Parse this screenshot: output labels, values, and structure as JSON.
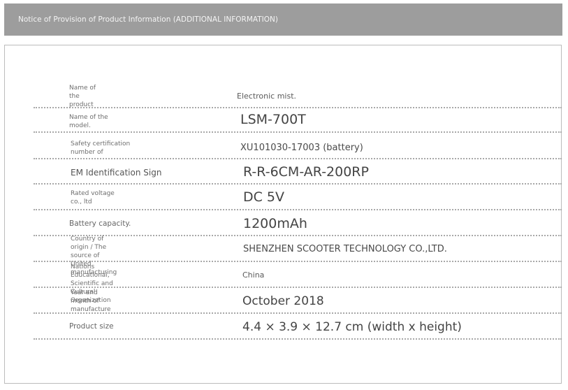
{
  "header": {
    "title": "Notice of Provision of Product Information (ADDITIONAL INFORMATION)"
  },
  "rows": [
    {
      "label": "Name of the product",
      "value": "Electronic mist."
    },
    {
      "label": "Name of the model.",
      "value": "LSM-700T"
    },
    {
      "label": "Safety certification number of",
      "value": "XU101030-17003 (battery)"
    },
    {
      "label": "EM Identification Sign",
      "value": "R-R-6CM-AR-200RP"
    },
    {
      "label": "Rated voltage co., ltd",
      "value": "DC 5V"
    },
    {
      "label": "Battery capacity.",
      "value": "1200mAh"
    },
    {
      "label": "Country of origin / The source of United manufacturing",
      "value": "SHENZHEN SCOOTER TECHNOLOGY CO.,LTD."
    },
    {
      "label": "Nations Educational, Scientific and Cultural Organization",
      "value": "China"
    },
    {
      "label": "Year and month of manufacture",
      "value": "October 2018"
    },
    {
      "label": "Product size",
      "value": "4.4 × 3.9 × 12.7 cm (width x height)"
    }
  ]
}
